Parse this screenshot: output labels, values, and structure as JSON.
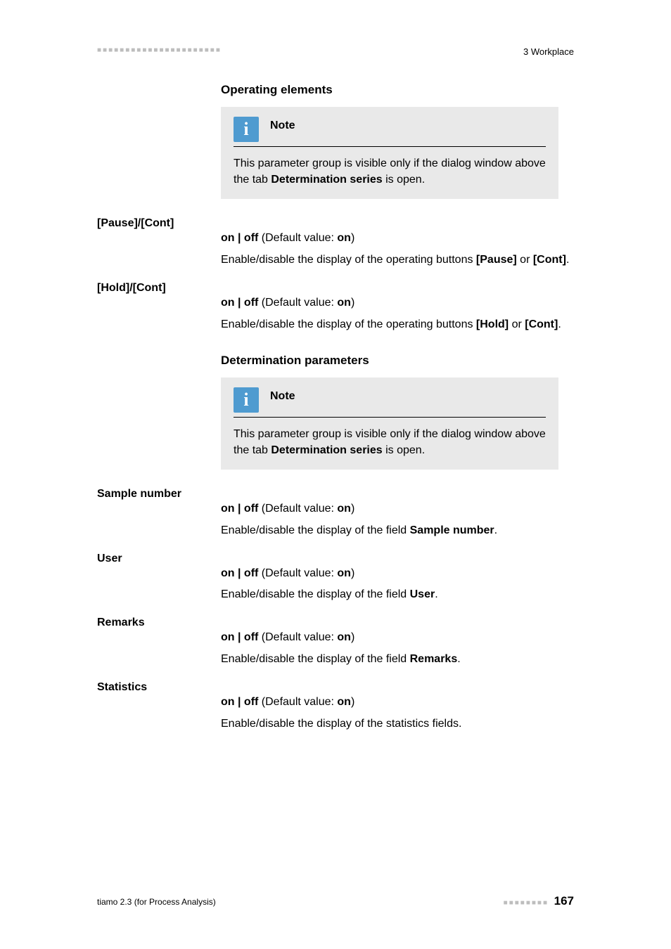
{
  "header": {
    "dashes": "■■■■■■■■■■■■■■■■■■■■■■",
    "section": "3 Workplace"
  },
  "sections": {
    "operating_elements": {
      "title": "Operating elements",
      "note_label": "Note",
      "note_text_prefix": "This parameter group is visible only if the dialog window above the tab ",
      "note_bold": "Determination series",
      "note_text_suffix": " is open."
    },
    "determination_parameters": {
      "title": "Determination parameters",
      "note_label": "Note",
      "note_text_prefix": "This parameter group is visible only if the dialog window above the tab ",
      "note_bold": "Determination series",
      "note_text_suffix": " is open."
    }
  },
  "params": {
    "pause_cont": {
      "label": "[Pause]/[Cont]",
      "value_bold1": "on | off",
      "value_mid": " (Default value: ",
      "value_bold2": "on",
      "value_close": ")",
      "desc_prefix": "Enable/disable the display of the operating buttons ",
      "desc_b1": "[Pause]",
      "desc_mid": " or ",
      "desc_b2": "[Cont]",
      "desc_suffix": "."
    },
    "hold_cont": {
      "label": "[Hold]/[Cont]",
      "value_bold1": "on | off",
      "value_mid": " (Default value: ",
      "value_bold2": "on",
      "value_close": ")",
      "desc_prefix": "Enable/disable the display of the operating buttons ",
      "desc_b1": "[Hold]",
      "desc_mid": " or ",
      "desc_b2": "[Cont]",
      "desc_suffix": "."
    },
    "sample_number": {
      "label": "Sample number",
      "value_bold1": "on | off",
      "value_mid": " (Default value: ",
      "value_bold2": "on",
      "value_close": ")",
      "desc_prefix": "Enable/disable the display of the field ",
      "desc_b1": "Sample number",
      "desc_suffix": "."
    },
    "user": {
      "label": "User",
      "value_bold1": "on | off",
      "value_mid": " (Default value: ",
      "value_bold2": "on",
      "value_close": ")",
      "desc_prefix": "Enable/disable the display of the field ",
      "desc_b1": "User",
      "desc_suffix": "."
    },
    "remarks": {
      "label": "Remarks",
      "value_bold1": "on | off",
      "value_mid": " (Default value: ",
      "value_bold2": "on",
      "value_close": ")",
      "desc_prefix": "Enable/disable the display of the field ",
      "desc_b1": "Remarks",
      "desc_suffix": "."
    },
    "statistics": {
      "label": "Statistics",
      "value_bold1": "on | off",
      "value_mid": " (Default value: ",
      "value_bold2": "on",
      "value_close": ")",
      "desc_full": "Enable/disable the display of the statistics fields."
    }
  },
  "footer": {
    "left": "tiamo 2.3 (for Process Analysis)",
    "dashes": "■■■■■■■■",
    "page": "167"
  },
  "icon_glyph": "i"
}
